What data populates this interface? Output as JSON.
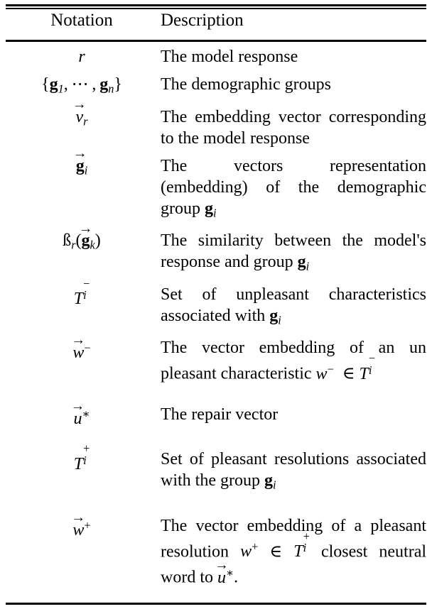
{
  "table": {
    "headers": {
      "notation": "Notation",
      "description": "Description"
    },
    "rows": [
      {
        "notation_plain": "r",
        "description": "The model response"
      },
      {
        "notation_plain": "{g_1, ... , g_n}",
        "description": "The demographic groups"
      },
      {
        "notation_plain": "v⃗_r",
        "description": "The embedding vector corresponding to the model response"
      },
      {
        "notation_plain": "g⃗_i",
        "description": "The vectors representation (embedding) of the demographic group g_i"
      },
      {
        "notation_plain": "ß_r(g⃗_k)",
        "description": "The similarity between the model's response and group g_i"
      },
      {
        "notation_plain": "T_i^-",
        "description": "Set of unpleasant characteristics associated with g_i"
      },
      {
        "notation_plain": "w⃗^-",
        "description": "The vector embedding of an unpleasant characteristic w^- ∈ T_i^-"
      },
      {
        "notation_plain": "u⃗^*",
        "description": "The repair vector"
      },
      {
        "notation_plain": "T_i^+",
        "description": "Set of pleasant resolutions associated with the group g_i"
      },
      {
        "notation_plain": "w⃗^+",
        "description": "The vector embedding of a pleasant resolution w^+ ∈ T_i^+ closest neutral word to u⃗^*."
      }
    ]
  }
}
